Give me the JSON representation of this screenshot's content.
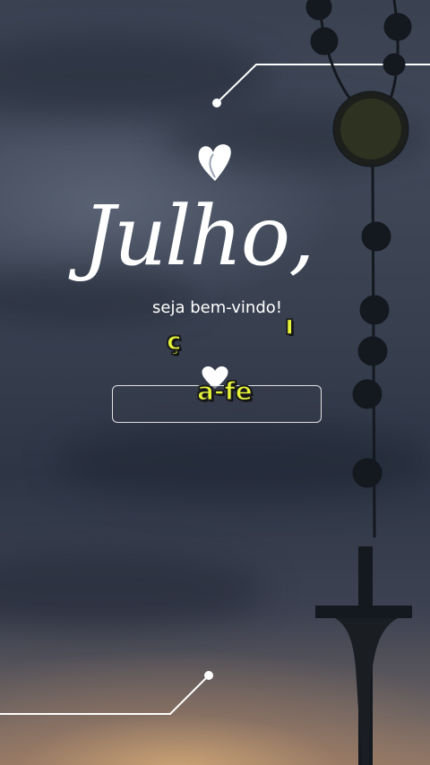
{
  "card": {
    "title": "Julho,",
    "subtitle": "seja bem-vindo!"
  },
  "captions": {
    "fragment_1": "ç",
    "fragment_2": "ı",
    "fragment_3": "a-fe"
  },
  "colors": {
    "caption_fill": "#e6f53a",
    "text": "#ffffff",
    "sky_top": "#3a4252",
    "sunset_glow": "#d6aa76"
  },
  "icons": [
    "heart-icon",
    "heart-outline-icon",
    "rosary-crucifix-icon"
  ]
}
